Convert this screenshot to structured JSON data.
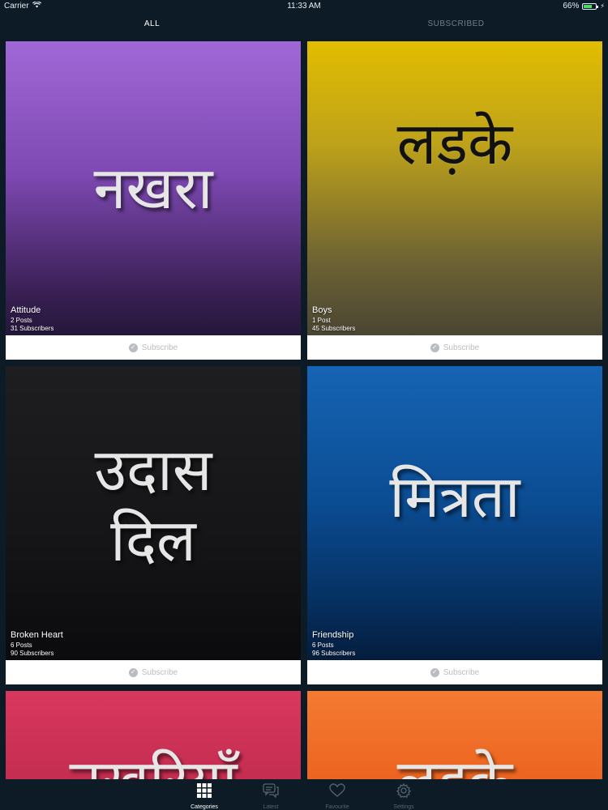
{
  "status": {
    "carrier": "Carrier",
    "time": "11:33 AM",
    "battery": "66%",
    "battery_level": 0.66
  },
  "tabs": [
    {
      "label": "ALL"
    },
    {
      "label": "SUBSCRIBED"
    }
  ],
  "cards": [
    {
      "hindi": "नखरा",
      "title": "Attitude",
      "posts": "2 Posts",
      "subscribers": "31 Subscribers",
      "subscribe": "Subscribe"
    },
    {
      "hindi": "लड़के",
      "title": "Boys",
      "posts": "1 Post",
      "subscribers": "45 Subscribers",
      "subscribe": "Subscribe"
    },
    {
      "hindi": "उदास\nदिल",
      "title": "Broken Heart",
      "posts": "6 Posts",
      "subscribers": "90 Subscribers",
      "subscribe": "Subscribe"
    },
    {
      "hindi": "मित्रता",
      "title": "Friendship",
      "posts": "6 Posts",
      "subscribers": "96 Subscribers",
      "subscribe": "Subscribe"
    },
    {
      "hindi": "नखरियाँ"
    },
    {
      "hindi": "लड़के"
    }
  ],
  "nav": [
    {
      "label": "Categories",
      "icon": "grid-icon"
    },
    {
      "label": "Latest",
      "icon": "chat-icon"
    },
    {
      "label": "Favourite",
      "icon": "heart-icon"
    },
    {
      "label": "Settings",
      "icon": "gear-icon"
    }
  ],
  "colors": {
    "background": "#0d1b27",
    "nav_active": "#ffffff",
    "nav_inactive": "#55646f"
  }
}
